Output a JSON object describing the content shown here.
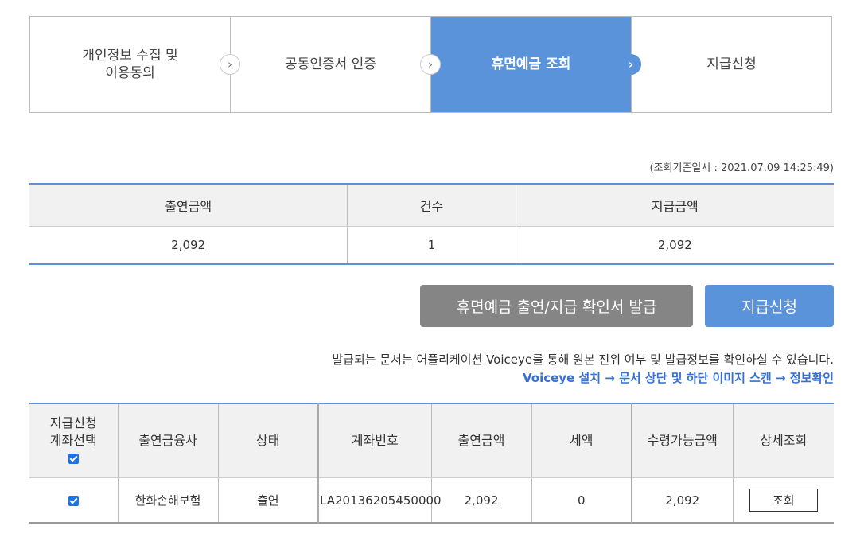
{
  "steps": [
    {
      "label": "개인정보 수집 및\n이용동의"
    },
    {
      "label": "공동인증서 인증"
    },
    {
      "label": "휴면예금 조회"
    },
    {
      "label": "지급신청"
    }
  ],
  "query_date": "(조회기준일시 : 2021.07.09 14:25:49)",
  "summary": {
    "headers": [
      "출연금액",
      "건수",
      "지급금액"
    ],
    "values": [
      "2,092",
      "1",
      "2,092"
    ]
  },
  "buttons": {
    "certificate": "휴면예금 출연/지급 확인서 발급",
    "apply": "지급신청"
  },
  "notice": {
    "text": "발급되는 문서는 어플리케이션 Voiceye를 통해 원본 진위 여부 및 발급정보를 확인하실 수 있습니다.",
    "link": "Voiceye 설치 → 문서 상단 및 하단 이미지 스캔 → 정보확인"
  },
  "detail": {
    "headers": [
      "지급신청\n계좌선택",
      "출연금융사",
      "상태",
      "계좌번호",
      "출연금액",
      "세액",
      "수령가능금액",
      "상세조회"
    ],
    "rows": [
      {
        "institution": "한화손해보험",
        "status": "출연",
        "account": "LA20136205450000",
        "amount": "2,092",
        "tax": "0",
        "receivable": "2,092",
        "action": "조회"
      }
    ]
  },
  "colors": {
    "accent": "#5b93db",
    "gray_button": "#858585",
    "link": "#3570d4"
  }
}
